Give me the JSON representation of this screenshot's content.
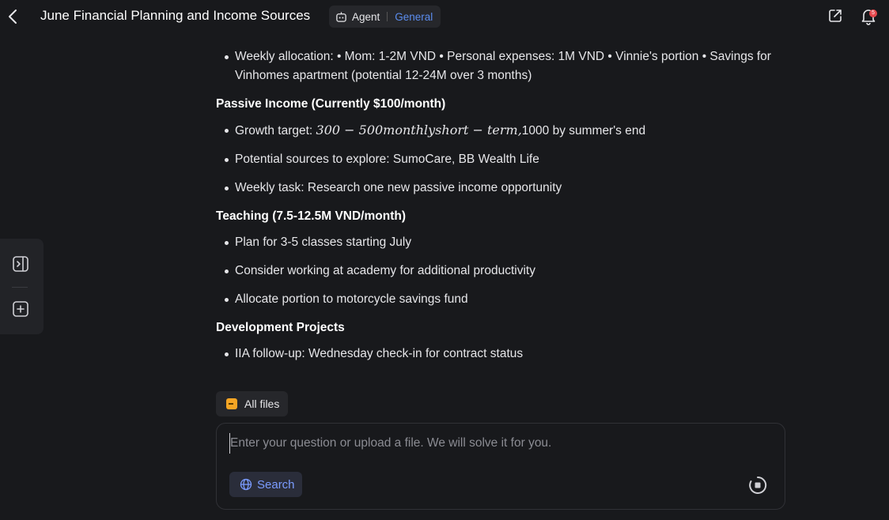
{
  "header": {
    "title": "June Financial Planning and Income Sources",
    "agent_label": "Agent",
    "mode_label": "General",
    "notification_count": "5"
  },
  "content": {
    "intro_items": [
      "Weekly allocation: • Mom: 1-2M VND • Personal expenses: 1M VND • Vinnie's portion • Savings for Vinhomes apartment (potential 12-24M over 3 months)"
    ],
    "sections": [
      {
        "title": "Passive Income (Currently $100/month)",
        "growth_prefix": "Growth target: ",
        "growth_math": "300 − 500monthlyshort − term,",
        "growth_suffix": "1000 by summer's end",
        "items": [
          "Potential sources to explore: SumoCare, BB Wealth Life",
          "Weekly task: Research one new passive income opportunity"
        ]
      },
      {
        "title": "Teaching (7.5-12.5M VND/month)",
        "items": [
          "Plan for 3-5 classes starting July",
          "Consider working at academy for additional productivity",
          "Allocate portion to motorcycle savings fund"
        ]
      },
      {
        "title": "Development Projects",
        "items": [
          "IIA follow-up: Wednesday check-in for contract status"
        ]
      }
    ]
  },
  "files_chip": {
    "label": "All files"
  },
  "composer": {
    "placeholder": "Enter your question or upload a file. We will solve it for you.",
    "search_label": "Search"
  },
  "colors": {
    "background": "#18191c",
    "accent": "#5b8def",
    "search_text": "#7b9cff",
    "badge": "#e5484d",
    "folder": "#f5a524"
  }
}
